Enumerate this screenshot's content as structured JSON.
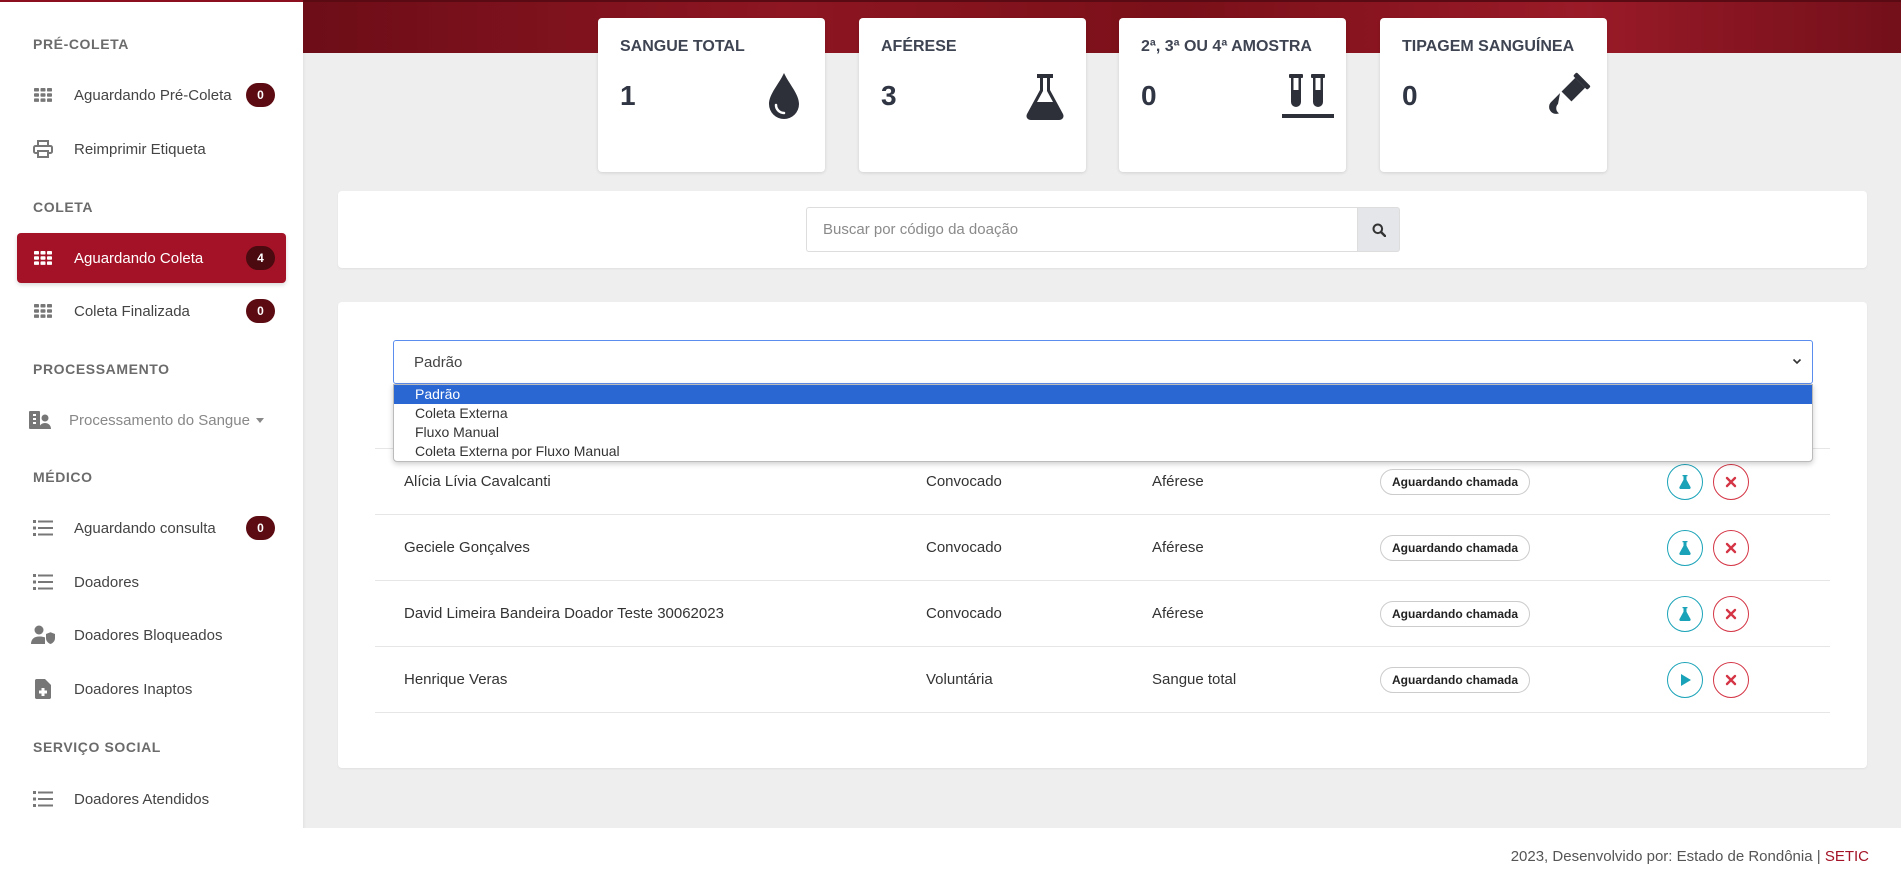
{
  "sidebar": {
    "sections": [
      {
        "label": "PRÉ-COLETA"
      },
      {
        "label": "COLETA"
      },
      {
        "label": "PROCESSAMENTO"
      },
      {
        "label": "MÉDICO"
      },
      {
        "label": "SERVIÇO SOCIAL"
      }
    ],
    "items": [
      {
        "label": "Aguardando Pré-Coleta",
        "icon": "grid-icon",
        "badge": "0"
      },
      {
        "label": "Reimprimir Etiqueta",
        "icon": "printer-icon"
      },
      {
        "label": "Aguardando Coleta",
        "icon": "grid-icon",
        "badge": "4",
        "active": true
      },
      {
        "label": "Coleta Finalizada",
        "icon": "grid-icon",
        "badge": "0"
      },
      {
        "label": "Processamento do Sangue",
        "icon": "hospital-user-icon"
      },
      {
        "label": "Aguardando consulta",
        "icon": "list-icon",
        "badge": "0"
      },
      {
        "label": "Doadores",
        "icon": "list-icon"
      },
      {
        "label": "Doadores Bloqueados",
        "icon": "user-shield-icon"
      },
      {
        "label": "Doadores Inaptos",
        "icon": "file-medical-icon"
      },
      {
        "label": "Doadores Atendidos",
        "icon": "list-icon"
      }
    ]
  },
  "cards": [
    {
      "title": "SANGUE TOTAL",
      "value": "1",
      "icon": "droplet-icon"
    },
    {
      "title": "AFÉRESE",
      "value": "3",
      "icon": "flask-icon"
    },
    {
      "title": "2ª, 3ª OU 4ª AMOSTRA",
      "value": "0",
      "icon": "test-tubes-icon"
    },
    {
      "title": "TIPAGEM SANGUÍNEA",
      "value": "0",
      "icon": "vial-icon"
    }
  ],
  "search": {
    "placeholder": "Buscar por código da doação",
    "icon": "search-icon"
  },
  "filter": {
    "selected": "Padrão",
    "options": [
      "Padrão",
      "Coleta Externa",
      "Fluxo Manual",
      "Coleta Externa por Fluxo Manual"
    ]
  },
  "rows": [
    {
      "name": "Alícia Lívia Cavalcanti",
      "type": "Convocado",
      "collection": "Aférese",
      "status": "Aguardando chamada",
      "action": "flask-icon"
    },
    {
      "name": "Geciele Gonçalves",
      "type": "Convocado",
      "collection": "Aférese",
      "status": "Aguardando chamada",
      "action": "flask-icon"
    },
    {
      "name": "David Limeira Bandeira Doador Teste 30062023",
      "type": "Convocado",
      "collection": "Aférese",
      "status": "Aguardando chamada",
      "action": "flask-icon"
    },
    {
      "name": "Henrique Veras",
      "type": "Voluntária",
      "collection": "Sangue total",
      "status": "Aguardando chamada",
      "action": "play-icon"
    }
  ],
  "footer": {
    "text": "2023, Desenvolvido por: Estado de Rondônia |",
    "link": "SETIC"
  },
  "colors": {
    "primary": "#a31226",
    "badge": "#5c0b12",
    "teal": "#1aa3b8",
    "danger": "#d43545",
    "selection": "#2a67d3"
  }
}
